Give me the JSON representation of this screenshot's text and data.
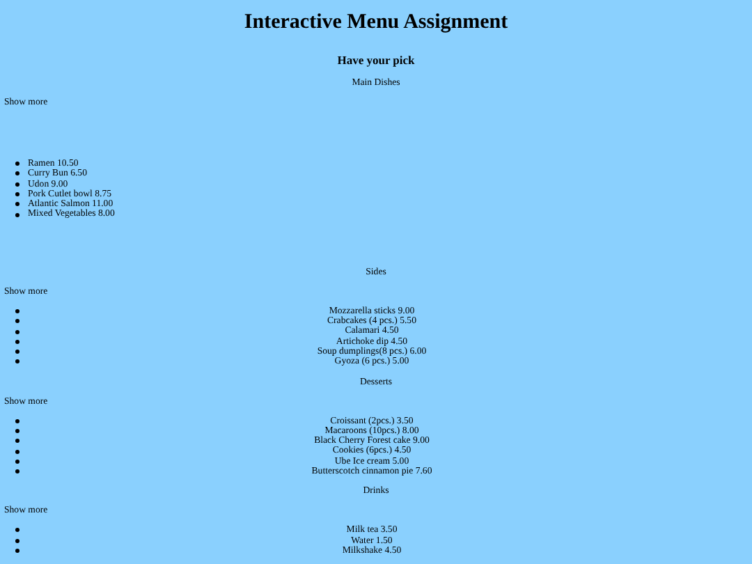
{
  "title": "Interactive Menu Assignment",
  "subtitle": "Have your pick",
  "sections": [
    {
      "heading": "Main Dishes",
      "toggle": "Show more",
      "kind": "left",
      "items": [
        "Ramen 10.50",
        "Curry Bun 6.50",
        "Udon 9.00",
        "Pork Cutlet bowl 8.75",
        "Atlantic Salmon 11.00",
        "Mixed Vegetables 8.00"
      ]
    },
    {
      "heading": "Sides",
      "toggle": "Show more",
      "kind": "centered",
      "items": [
        "Mozzarella sticks 9.00",
        "Crabcakes (4 pcs.) 5.50",
        "Calamari 4.50",
        "Artichoke dip 4.50",
        "Soup dumplings(8 pcs.) 6.00",
        "Gyoza (6 pcs.) 5.00"
      ]
    },
    {
      "heading": "Desserts",
      "toggle": "Show more",
      "kind": "centered",
      "items": [
        "Croissant (2pcs.) 3.50",
        "Macaroons (10pcs.) 8.00",
        "Black Cherry Forest cake 9.00",
        "Cookies (6pcs.) 4.50",
        "Ube Ice cream 5.00",
        "Butterscotch cinnamon pie 7.60"
      ]
    },
    {
      "heading": "Drinks",
      "toggle": "Show more",
      "kind": "centered",
      "items": [
        "Milk tea 3.50",
        "Water 1.50",
        "Milkshake 4.50"
      ]
    }
  ]
}
